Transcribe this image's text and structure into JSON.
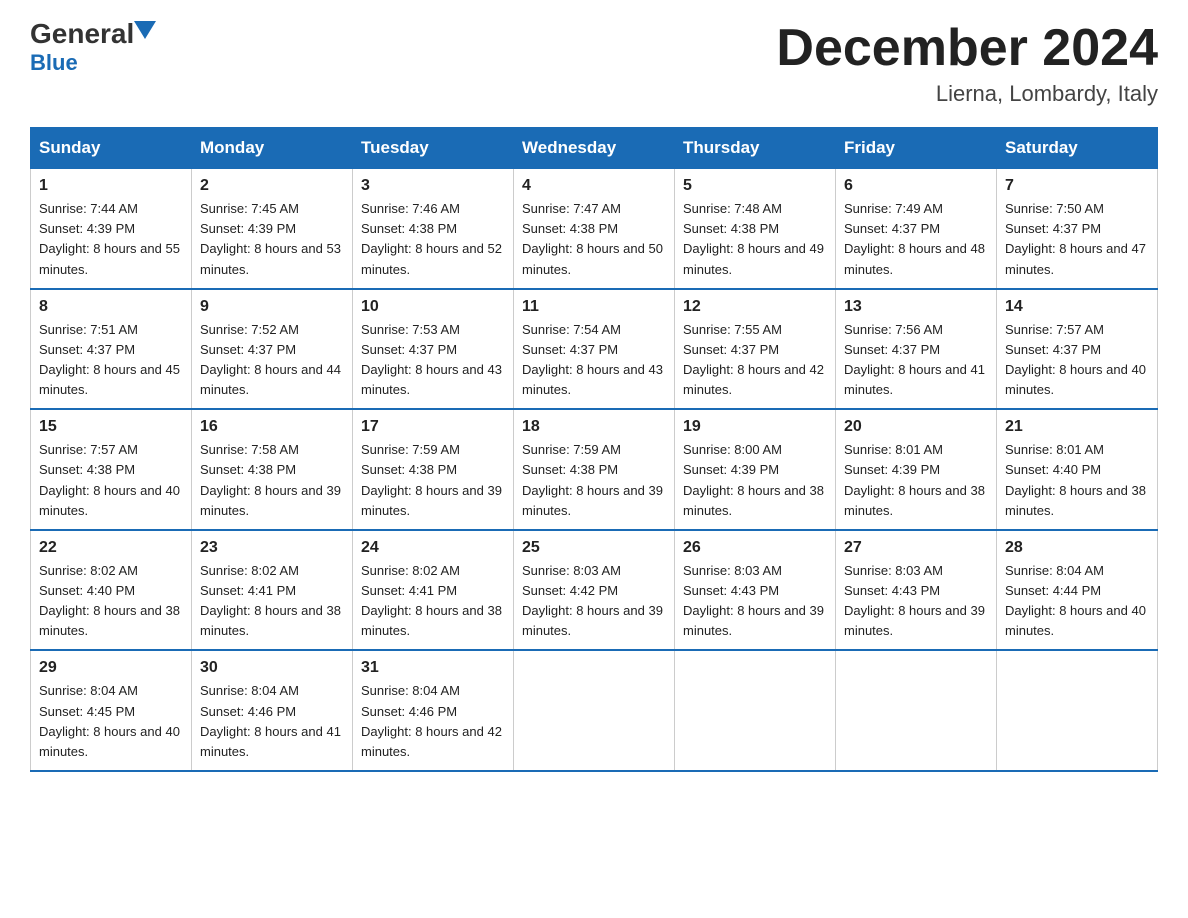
{
  "logo": {
    "general": "General",
    "blue": "Blue",
    "triangle": "▼"
  },
  "header": {
    "month": "December 2024",
    "location": "Lierna, Lombardy, Italy"
  },
  "days_of_week": [
    "Sunday",
    "Monday",
    "Tuesday",
    "Wednesday",
    "Thursday",
    "Friday",
    "Saturday"
  ],
  "weeks": [
    [
      {
        "num": "1",
        "sunrise": "Sunrise: 7:44 AM",
        "sunset": "Sunset: 4:39 PM",
        "daylight": "Daylight: 8 hours and 55 minutes."
      },
      {
        "num": "2",
        "sunrise": "Sunrise: 7:45 AM",
        "sunset": "Sunset: 4:39 PM",
        "daylight": "Daylight: 8 hours and 53 minutes."
      },
      {
        "num": "3",
        "sunrise": "Sunrise: 7:46 AM",
        "sunset": "Sunset: 4:38 PM",
        "daylight": "Daylight: 8 hours and 52 minutes."
      },
      {
        "num": "4",
        "sunrise": "Sunrise: 7:47 AM",
        "sunset": "Sunset: 4:38 PM",
        "daylight": "Daylight: 8 hours and 50 minutes."
      },
      {
        "num": "5",
        "sunrise": "Sunrise: 7:48 AM",
        "sunset": "Sunset: 4:38 PM",
        "daylight": "Daylight: 8 hours and 49 minutes."
      },
      {
        "num": "6",
        "sunrise": "Sunrise: 7:49 AM",
        "sunset": "Sunset: 4:37 PM",
        "daylight": "Daylight: 8 hours and 48 minutes."
      },
      {
        "num": "7",
        "sunrise": "Sunrise: 7:50 AM",
        "sunset": "Sunset: 4:37 PM",
        "daylight": "Daylight: 8 hours and 47 minutes."
      }
    ],
    [
      {
        "num": "8",
        "sunrise": "Sunrise: 7:51 AM",
        "sunset": "Sunset: 4:37 PM",
        "daylight": "Daylight: 8 hours and 45 minutes."
      },
      {
        "num": "9",
        "sunrise": "Sunrise: 7:52 AM",
        "sunset": "Sunset: 4:37 PM",
        "daylight": "Daylight: 8 hours and 44 minutes."
      },
      {
        "num": "10",
        "sunrise": "Sunrise: 7:53 AM",
        "sunset": "Sunset: 4:37 PM",
        "daylight": "Daylight: 8 hours and 43 minutes."
      },
      {
        "num": "11",
        "sunrise": "Sunrise: 7:54 AM",
        "sunset": "Sunset: 4:37 PM",
        "daylight": "Daylight: 8 hours and 43 minutes."
      },
      {
        "num": "12",
        "sunrise": "Sunrise: 7:55 AM",
        "sunset": "Sunset: 4:37 PM",
        "daylight": "Daylight: 8 hours and 42 minutes."
      },
      {
        "num": "13",
        "sunrise": "Sunrise: 7:56 AM",
        "sunset": "Sunset: 4:37 PM",
        "daylight": "Daylight: 8 hours and 41 minutes."
      },
      {
        "num": "14",
        "sunrise": "Sunrise: 7:57 AM",
        "sunset": "Sunset: 4:37 PM",
        "daylight": "Daylight: 8 hours and 40 minutes."
      }
    ],
    [
      {
        "num": "15",
        "sunrise": "Sunrise: 7:57 AM",
        "sunset": "Sunset: 4:38 PM",
        "daylight": "Daylight: 8 hours and 40 minutes."
      },
      {
        "num": "16",
        "sunrise": "Sunrise: 7:58 AM",
        "sunset": "Sunset: 4:38 PM",
        "daylight": "Daylight: 8 hours and 39 minutes."
      },
      {
        "num": "17",
        "sunrise": "Sunrise: 7:59 AM",
        "sunset": "Sunset: 4:38 PM",
        "daylight": "Daylight: 8 hours and 39 minutes."
      },
      {
        "num": "18",
        "sunrise": "Sunrise: 7:59 AM",
        "sunset": "Sunset: 4:38 PM",
        "daylight": "Daylight: 8 hours and 39 minutes."
      },
      {
        "num": "19",
        "sunrise": "Sunrise: 8:00 AM",
        "sunset": "Sunset: 4:39 PM",
        "daylight": "Daylight: 8 hours and 38 minutes."
      },
      {
        "num": "20",
        "sunrise": "Sunrise: 8:01 AM",
        "sunset": "Sunset: 4:39 PM",
        "daylight": "Daylight: 8 hours and 38 minutes."
      },
      {
        "num": "21",
        "sunrise": "Sunrise: 8:01 AM",
        "sunset": "Sunset: 4:40 PM",
        "daylight": "Daylight: 8 hours and 38 minutes."
      }
    ],
    [
      {
        "num": "22",
        "sunrise": "Sunrise: 8:02 AM",
        "sunset": "Sunset: 4:40 PM",
        "daylight": "Daylight: 8 hours and 38 minutes."
      },
      {
        "num": "23",
        "sunrise": "Sunrise: 8:02 AM",
        "sunset": "Sunset: 4:41 PM",
        "daylight": "Daylight: 8 hours and 38 minutes."
      },
      {
        "num": "24",
        "sunrise": "Sunrise: 8:02 AM",
        "sunset": "Sunset: 4:41 PM",
        "daylight": "Daylight: 8 hours and 38 minutes."
      },
      {
        "num": "25",
        "sunrise": "Sunrise: 8:03 AM",
        "sunset": "Sunset: 4:42 PM",
        "daylight": "Daylight: 8 hours and 39 minutes."
      },
      {
        "num": "26",
        "sunrise": "Sunrise: 8:03 AM",
        "sunset": "Sunset: 4:43 PM",
        "daylight": "Daylight: 8 hours and 39 minutes."
      },
      {
        "num": "27",
        "sunrise": "Sunrise: 8:03 AM",
        "sunset": "Sunset: 4:43 PM",
        "daylight": "Daylight: 8 hours and 39 minutes."
      },
      {
        "num": "28",
        "sunrise": "Sunrise: 8:04 AM",
        "sunset": "Sunset: 4:44 PM",
        "daylight": "Daylight: 8 hours and 40 minutes."
      }
    ],
    [
      {
        "num": "29",
        "sunrise": "Sunrise: 8:04 AM",
        "sunset": "Sunset: 4:45 PM",
        "daylight": "Daylight: 8 hours and 40 minutes."
      },
      {
        "num": "30",
        "sunrise": "Sunrise: 8:04 AM",
        "sunset": "Sunset: 4:46 PM",
        "daylight": "Daylight: 8 hours and 41 minutes."
      },
      {
        "num": "31",
        "sunrise": "Sunrise: 8:04 AM",
        "sunset": "Sunset: 4:46 PM",
        "daylight": "Daylight: 8 hours and 42 minutes."
      },
      null,
      null,
      null,
      null
    ]
  ]
}
